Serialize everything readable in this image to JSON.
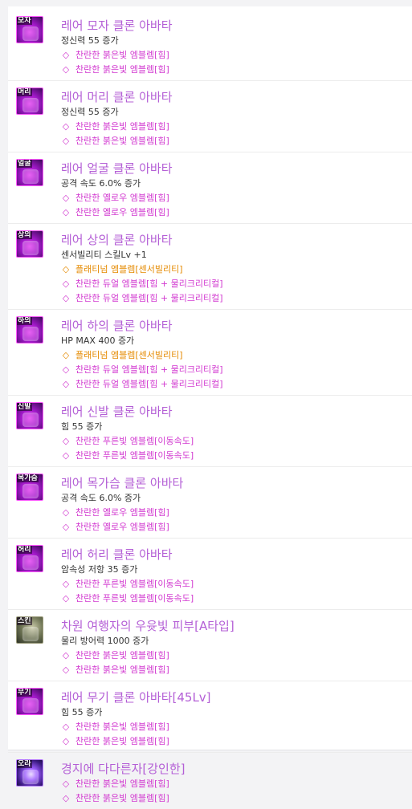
{
  "colors": {
    "title": "#b45fd6",
    "emblem_pink": "#d23ad0",
    "emblem_orange": "#e58a00",
    "stat": "#333333",
    "icon_border": "#ff58ff"
  },
  "items": [
    {
      "icon": "hat-avatar-icon",
      "icon_tag": "모자",
      "icon_kind": "rare",
      "title": "레어 모자 클론 아바타",
      "stat": "정신력 55 증가",
      "emblems": [
        {
          "color": "pink",
          "icon": "gem-icon",
          "text": "찬란한 붉은빛 엠블렘[힘]"
        },
        {
          "color": "pink",
          "icon": "gem-icon",
          "text": "찬란한 붉은빛 엠블렘[힘]"
        }
      ]
    },
    {
      "icon": "hair-avatar-icon",
      "icon_tag": "머리",
      "icon_kind": "rare",
      "title": "레어 머리 클론 아바타",
      "stat": "정신력 55 증가",
      "emblems": [
        {
          "color": "pink",
          "icon": "gem-icon",
          "text": "찬란한 붉은빛 엠블렘[힘]"
        },
        {
          "color": "pink",
          "icon": "gem-icon",
          "text": "찬란한 붉은빛 엠블렘[힘]"
        }
      ]
    },
    {
      "icon": "face-avatar-icon",
      "icon_tag": "얼굴",
      "icon_kind": "rare",
      "title": "레어 얼굴 클론 아바타",
      "stat": "공격 속도 6.0% 증가",
      "emblems": [
        {
          "color": "pink",
          "icon": "gem-icon",
          "text": "찬란한 옐로우 엠블렘[힘]"
        },
        {
          "color": "pink",
          "icon": "gem-icon",
          "text": "찬란한 옐로우 엠블렘[힘]"
        }
      ]
    },
    {
      "icon": "top-avatar-icon",
      "icon_tag": "상의",
      "icon_kind": "rare",
      "title": "레어 상의 클론 아바타",
      "stat": "센서빌리티 스킬Lv +1",
      "emblems": [
        {
          "color": "orange",
          "icon": "gem-icon",
          "text": "플래티넘 엠블렘[센서빌리티]"
        },
        {
          "color": "pink",
          "icon": "gem-icon",
          "text": "찬란한 듀얼 엠블렘[힘 + 물리크리티컬]"
        },
        {
          "color": "pink",
          "icon": "gem-icon",
          "text": "찬란한 듀얼 엠블렘[힘 + 물리크리티컬]"
        }
      ]
    },
    {
      "icon": "bottom-avatar-icon",
      "icon_tag": "하의",
      "icon_kind": "rare",
      "title": "레어 하의 클론 아바타",
      "stat": "HP MAX 400 증가",
      "emblems": [
        {
          "color": "orange",
          "icon": "gem-icon",
          "text": "플래티넘 엠블렘[센서빌리티]"
        },
        {
          "color": "pink",
          "icon": "gem-icon",
          "text": "찬란한 듀얼 엠블렘[힘 + 물리크리티컬]"
        },
        {
          "color": "pink",
          "icon": "gem-icon",
          "text": "찬란한 듀얼 엠블렘[힘 + 물리크리티컬]"
        }
      ]
    },
    {
      "icon": "shoes-avatar-icon",
      "icon_tag": "신발",
      "icon_kind": "rare",
      "title": "레어 신발 클론 아바타",
      "stat": "힘 55 증가",
      "emblems": [
        {
          "color": "pink",
          "icon": "gem-icon",
          "text": "찬란한 푸른빛 엠블렘[이동속도]"
        },
        {
          "color": "pink",
          "icon": "gem-icon",
          "text": "찬란한 푸른빛 엠블렘[이동속도]"
        }
      ]
    },
    {
      "icon": "neck-avatar-icon",
      "icon_tag": "목가슴",
      "icon_kind": "rare",
      "title": "레어 목가슴 클론 아바타",
      "stat": "공격 속도 6.0% 증가",
      "emblems": [
        {
          "color": "pink",
          "icon": "gem-icon",
          "text": "찬란한 옐로우 엠블렘[힘]"
        },
        {
          "color": "pink",
          "icon": "gem-icon",
          "text": "찬란한 옐로우 엠블렘[힘]"
        }
      ]
    },
    {
      "icon": "belt-avatar-icon",
      "icon_tag": "허리",
      "icon_kind": "rare",
      "title": "레어 허리 클론 아바타",
      "stat": "암속성 저항 35 증가",
      "emblems": [
        {
          "color": "pink",
          "icon": "gem-icon",
          "text": "찬란한 푸른빛 엠블렘[이동속도]"
        },
        {
          "color": "pink",
          "icon": "gem-icon",
          "text": "찬란한 푸른빛 엠블렘[이동속도]"
        }
      ]
    },
    {
      "icon": "skin-avatar-icon",
      "icon_tag": "스킨",
      "icon_kind": "skin",
      "title": "차원 여행자의 우윳빛 피부[A타입]",
      "stat": "물리 방어력 1000 증가",
      "emblems": [
        {
          "color": "pink",
          "icon": "gem-icon",
          "text": "찬란한 붉은빛 엠블렘[힘]"
        },
        {
          "color": "pink",
          "icon": "gem-icon",
          "text": "찬란한 붉은빛 엠블렘[힘]"
        }
      ]
    },
    {
      "icon": "weapon-avatar-icon",
      "icon_tag": "무기",
      "icon_kind": "rare",
      "title": "레어 무기 클론 아바타[45Lv]",
      "stat": "힘 55 증가",
      "emblems": [
        {
          "color": "pink",
          "icon": "gem-icon",
          "text": "찬란한 붉은빛 엠블렘[힘]"
        },
        {
          "color": "pink",
          "icon": "gem-icon",
          "text": "찬란한 붉은빛 엠블렘[힘]"
        }
      ]
    },
    {
      "icon": "aura-avatar-icon",
      "icon_tag": "오라",
      "icon_kind": "aura",
      "title": "경지에 다다른자[강인한]",
      "stat": "",
      "emblems": [
        {
          "color": "pink",
          "icon": "gem-icon",
          "text": "찬란한 붉은빛 엠블렘[힘]"
        },
        {
          "color": "pink",
          "icon": "gem-icon",
          "text": "찬란한 붉은빛 엠블렘[힘]"
        }
      ]
    }
  ]
}
